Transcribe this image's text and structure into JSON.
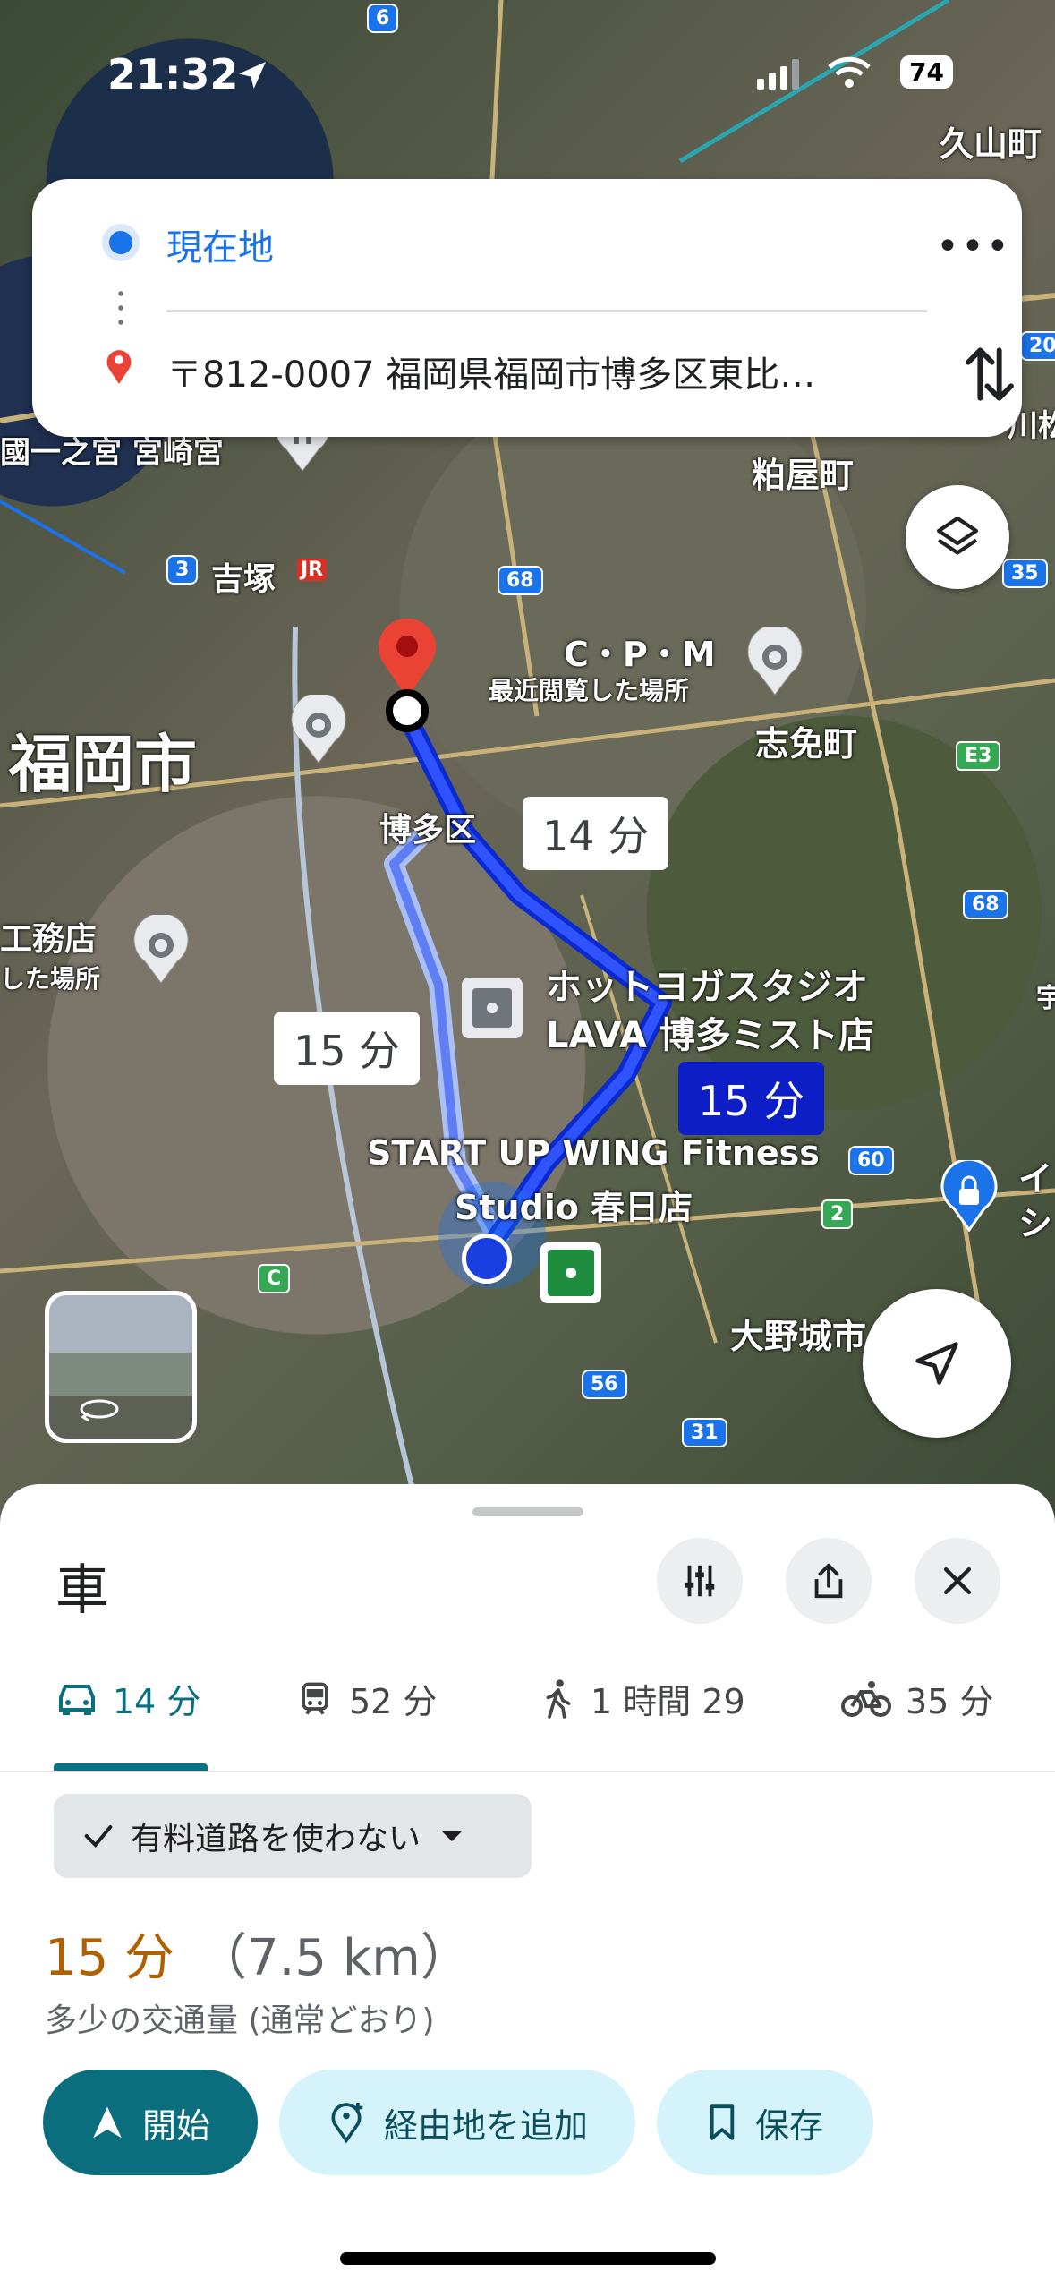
{
  "status": {
    "time": "21:32",
    "battery": "74"
  },
  "directions": {
    "origin": "現在地",
    "destination": "〒812-0007 福岡県福岡市博多区東比…",
    "more_label": "•••"
  },
  "map": {
    "labels": {
      "kusuyama": "久山町",
      "ichinomiya": "國一之宮 宮崎宮",
      "kasuya": "粕屋町",
      "yoshizuka": "吉塚",
      "cpm": "C・P・M",
      "recent1": "最近閲覧した場所",
      "shime": "志免町",
      "fukuoka": "福岡市",
      "hakata": "博多区",
      "koumuten": "工務店",
      "recent2": "した場所",
      "hotyoga1": "ホットヨガスタジオ",
      "hotyoga2": "LAVA 博多ミスト店",
      "startup1": "START UP WING Fitness",
      "startup2": "Studio 春日店",
      "onojo": "大野城市",
      "jr": "JR",
      "edge1": "イ",
      "edge2": "シ",
      "edge3": "宇",
      "edge4": "川松"
    },
    "shields": [
      "6",
      "3",
      "68",
      "35",
      "E3",
      "68",
      "60",
      "2",
      "C",
      "56",
      "31",
      "20"
    ],
    "route_times": {
      "t1": "14 分",
      "t2": "15 分",
      "t3": "15 分"
    }
  },
  "sheet": {
    "title": "車",
    "tabs": [
      {
        "label": "14 分",
        "icon": "car-icon"
      },
      {
        "label": "52 分",
        "icon": "train-icon"
      },
      {
        "label": "1 時間 29",
        "icon": "walk-icon"
      },
      {
        "label": "35 分",
        "icon": "bike-icon"
      }
    ],
    "chip": "有料道路を使わない",
    "duration": "15 分",
    "distance": "（7.5 km）",
    "traffic": "多少の交通量 (通常どおり)",
    "buttons": {
      "start": "開始",
      "add_stop": "経由地を追加",
      "save": "保存"
    }
  },
  "colors": {
    "accent": "#0b6e7e",
    "route": "#1a3fe0",
    "pin": "#ea4335"
  }
}
